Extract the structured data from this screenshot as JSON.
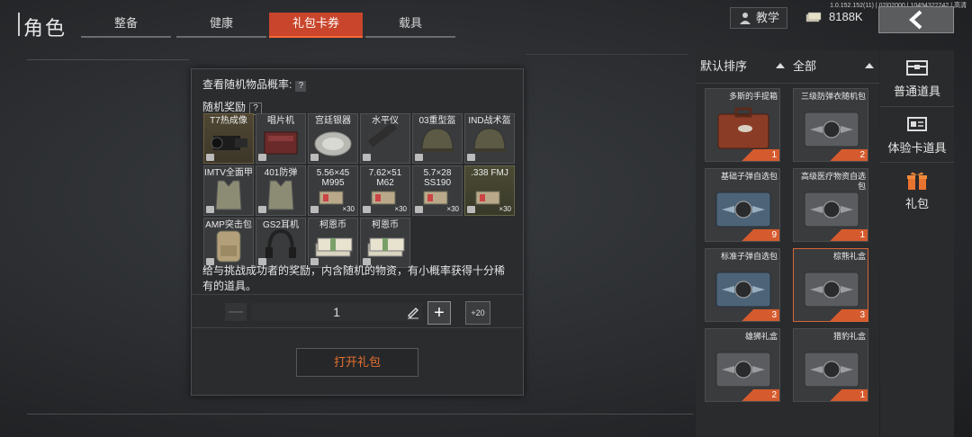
{
  "header": {
    "title": "角色",
    "tabs": [
      {
        "label": "整备",
        "active": false
      },
      {
        "label": "健康",
        "active": false
      },
      {
        "label": "礼包卡券",
        "active": true
      },
      {
        "label": "载具",
        "active": false
      }
    ],
    "version": "1.0.152.152(11) | 02|02000 | 10494322242 | 高清",
    "tutorial_label": "教学",
    "money": "8188K"
  },
  "dialog": {
    "probability_label": "查看随机物品概率:",
    "rewards_label": "随机奖励",
    "rewards": [
      {
        "name": "T7热成像",
        "qty": "",
        "icon": "thermal-camera-icon",
        "rarity": "rare"
      },
      {
        "name": "唱片机",
        "qty": "",
        "icon": "record-player-icon",
        "rarity": "normal"
      },
      {
        "name": "宫廷银器",
        "qty": "",
        "icon": "silver-plate-icon",
        "rarity": "normal"
      },
      {
        "name": "水平仪",
        "qty": "",
        "icon": "level-tool-icon",
        "rarity": "normal"
      },
      {
        "name": "03重型盔",
        "qty": "",
        "icon": "helmet-icon",
        "rarity": "normal"
      },
      {
        "name": "IND战术盔",
        "qty": "",
        "icon": "helmet-icon",
        "rarity": "normal"
      },
      {
        "name": "IMTV全面甲",
        "qty": "",
        "icon": "body-armor-icon",
        "rarity": "normal"
      },
      {
        "name": "401防弹",
        "qty": "",
        "icon": "body-armor-icon",
        "rarity": "normal"
      },
      {
        "name": "5.56×45 M995",
        "qty": "×30",
        "icon": "ammo-icon",
        "rarity": "normal"
      },
      {
        "name": "7.62×51 M62",
        "qty": "×30",
        "icon": "ammo-icon",
        "rarity": "normal"
      },
      {
        "name": "5.7×28 SS190",
        "qty": "×30",
        "icon": "ammo-icon",
        "rarity": "normal"
      },
      {
        "name": ".338 FMJ",
        "qty": "×30",
        "icon": "ammo-icon",
        "rarity": "rare2"
      },
      {
        "name": "AMP突击包",
        "qty": "",
        "icon": "backpack-icon",
        "rarity": "normal"
      },
      {
        "name": "GS2耳机",
        "qty": "",
        "icon": "headset-icon",
        "rarity": "normal"
      },
      {
        "name": "柯恩币",
        "qty": "",
        "icon": "cash-stack-icon",
        "rarity": "normal"
      },
      {
        "name": "柯恩币",
        "qty": "",
        "icon": "cash-stack-icon",
        "rarity": "normal"
      }
    ],
    "description": "给与挑战成功者的奖励，内含随机的物资，有小概率获得十分稀有的道具。",
    "quantity": "1",
    "plus20_label": "+20",
    "open_button_label": "打开礼包"
  },
  "inventory": {
    "sort_label": "默认排序",
    "filter_label": "全部",
    "items": [
      {
        "name": "多斯的手提箱",
        "count": "1",
        "icon": "briefcase-icon",
        "selected": false
      },
      {
        "name": "三级防弹衣随机包",
        "count": "2",
        "icon": "crate-icon",
        "selected": false
      },
      {
        "name": "基础子弹自选包",
        "count": "9",
        "icon": "crate-blue-icon",
        "selected": false
      },
      {
        "name": "高级医疗物资自选包",
        "count": "1",
        "icon": "crate-icon",
        "selected": false
      },
      {
        "name": "标准子弹自选包",
        "count": "3",
        "icon": "crate-blue-icon",
        "selected": false
      },
      {
        "name": "棕熊礼盒",
        "count": "3",
        "icon": "crate-icon",
        "selected": true
      },
      {
        "name": "雄狮礼盒",
        "count": "2",
        "icon": "crate-icon",
        "selected": false
      },
      {
        "name": "猎豹礼盒",
        "count": "1",
        "icon": "crate-icon",
        "selected": false
      }
    ]
  },
  "side_nav": [
    {
      "label": "普通道具",
      "icon": "chest-icon"
    },
    {
      "label": "体验卡道具",
      "icon": "card-icon"
    },
    {
      "label": "礼包",
      "icon": "gift-icon"
    }
  ],
  "colors": {
    "accent": "#c9452b",
    "open_button_text": "#e8702f",
    "count_badge": "#d55b2e"
  }
}
